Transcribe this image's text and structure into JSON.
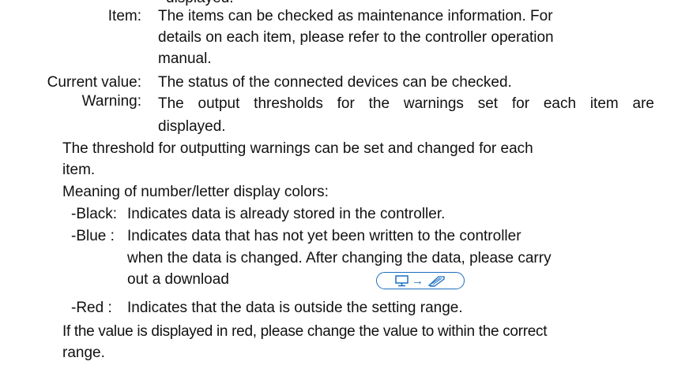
{
  "header_fragment": "displayed.",
  "definitions": [
    {
      "term": "Item:",
      "desc_lines": [
        "The items can be checked as maintenance information. For",
        "details on each item, please refer to the controller operation",
        "manual."
      ]
    },
    {
      "term": "Current value:",
      "desc_lines": [
        "The status of the connected devices can be checked."
      ]
    },
    {
      "term": "Warning:",
      "desc_lines": [
        "The output thresholds for the warnings set for each item are",
        "displayed."
      ]
    }
  ],
  "threshold_note": [
    "The threshold for outputting warnings can be set and changed for each",
    "item."
  ],
  "colors_heading": "Meaning of number/letter display colors:",
  "color_items": {
    "black": {
      "label": "-Black:",
      "text": "Indicates data is already stored in the controller."
    },
    "blue": {
      "label": "-Blue :",
      "lines": [
        "Indicates data that has not yet been written to the controller",
        "when the data is changed. After changing the data, please carry",
        "out a download"
      ]
    },
    "red": {
      "label": "-Red   :",
      "text": "Indicates that the data is outside the setting range."
    }
  },
  "download_button": {
    "arrow": "→",
    "icons": [
      "monitor-icon",
      "controller-icon"
    ],
    "accent": "#1b6fc2"
  },
  "final_note": [
    "If the value is displayed in red, please change the value to within the correct",
    "range."
  ]
}
